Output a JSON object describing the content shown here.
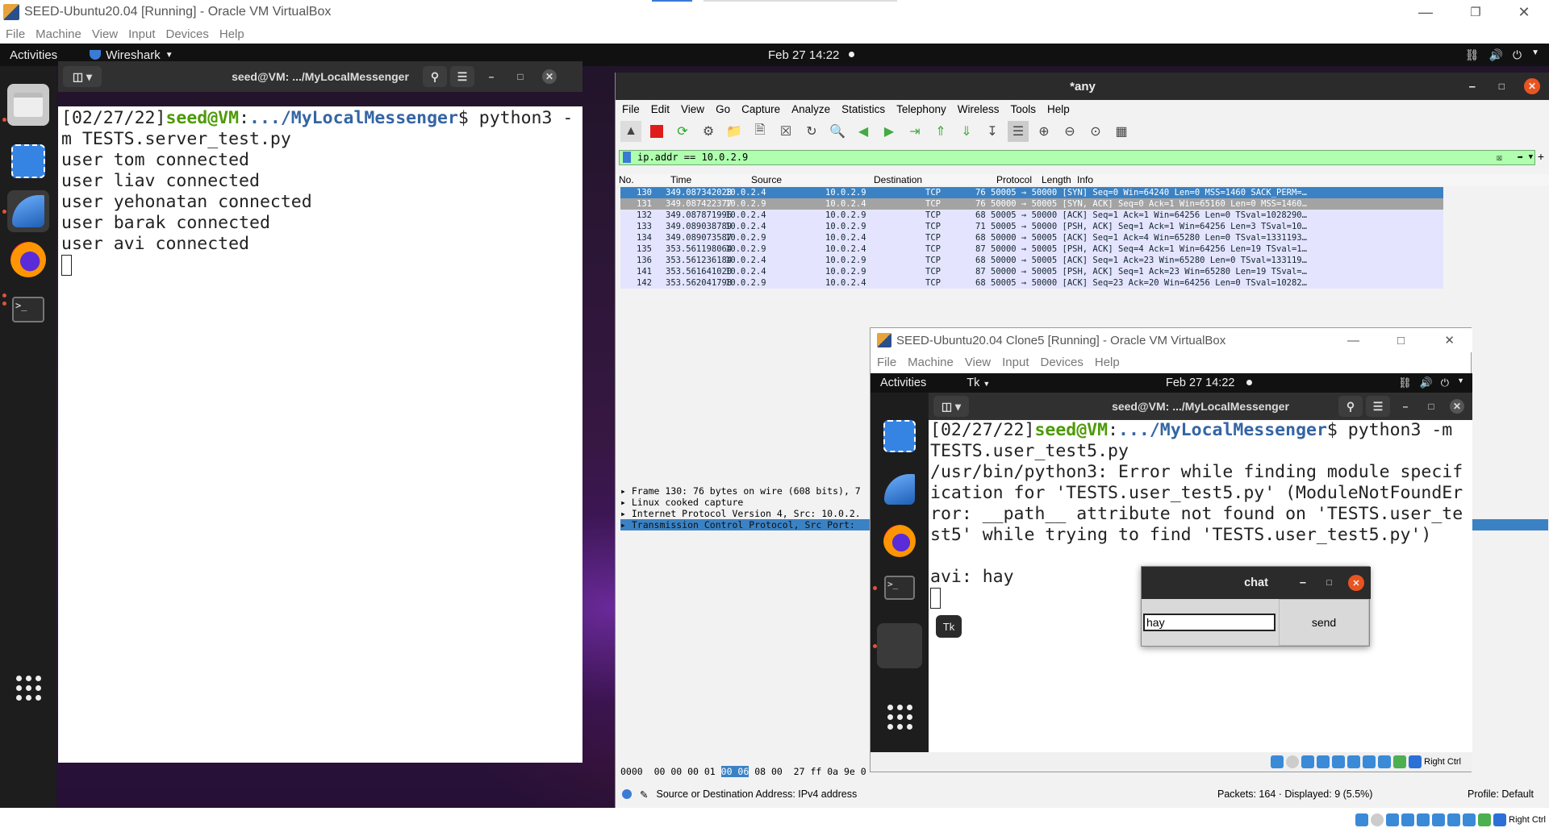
{
  "host": {
    "title": "SEED-Ubuntu20.04 [Running] - Oracle VM VirtualBox",
    "menu": [
      "File",
      "Machine",
      "View",
      "Input",
      "Devices",
      "Help"
    ],
    "status_key": "Right Ctrl"
  },
  "guest": {
    "activities": "Activities",
    "app_menu": "Wireshark",
    "clock": "Feb 27  14:22"
  },
  "terminal": {
    "title": "seed@VM: .../MyLocalMessenger",
    "prompt_date": "[02/27/22]",
    "prompt_user": "seed@VM",
    "prompt_sep": ":",
    "prompt_path": ".../MyLocalMessenger",
    "command": "$ python3 -m TESTS.server_test.py",
    "output": [
      "user tom connected",
      "user liav connected",
      "user yehonatan connected",
      "user barak connected",
      "user avi connected"
    ]
  },
  "wireshark": {
    "title": "*any",
    "menu": [
      "File",
      "Edit",
      "View",
      "Go",
      "Capture",
      "Analyze",
      "Statistics",
      "Telephony",
      "Wireless",
      "Tools",
      "Help"
    ],
    "filter": "ip.addr == 10.0.2.9",
    "columns": [
      "No.",
      "Time",
      "Source",
      "Destination",
      "Protocol",
      "Length",
      "Info"
    ],
    "packets": [
      {
        "no": "130",
        "time": "349.087342028",
        "src": "10.0.2.4",
        "dst": "10.0.2.9",
        "proto": "TCP",
        "len": "76",
        "info": "50005 → 50000 [SYN] Seq=0 Win=64240 Len=0 MSS=1460 SACK_PERM=…"
      },
      {
        "no": "131",
        "time": "349.087422377",
        "src": "10.0.2.9",
        "dst": "10.0.2.4",
        "proto": "TCP",
        "len": "76",
        "info": "50000 → 50005 [SYN, ACK] Seq=0 Ack=1 Win=65160 Len=0 MSS=1460…"
      },
      {
        "no": "132",
        "time": "349.087871996",
        "src": "10.0.2.4",
        "dst": "10.0.2.9",
        "proto": "TCP",
        "len": "68",
        "info": "50005 → 50000 [ACK] Seq=1 Ack=1 Win=64256 Len=0 TSval=1028290…"
      },
      {
        "no": "133",
        "time": "349.089038789",
        "src": "10.0.2.4",
        "dst": "10.0.2.9",
        "proto": "TCP",
        "len": "71",
        "info": "50005 → 50000 [PSH, ACK] Seq=1 Ack=1 Win=64256 Len=3 TSval=10…"
      },
      {
        "no": "134",
        "time": "349.089073587",
        "src": "10.0.2.9",
        "dst": "10.0.2.4",
        "proto": "TCP",
        "len": "68",
        "info": "50000 → 50005 [ACK] Seq=1 Ack=4 Win=65280 Len=0 TSval=1331193…"
      },
      {
        "no": "135",
        "time": "353.561198064",
        "src": "10.0.2.9",
        "dst": "10.0.2.4",
        "proto": "TCP",
        "len": "87",
        "info": "50000 → 50005 [PSH, ACK] Seq=4 Ack=1 Win=64256 Len=19 TSval=1…"
      },
      {
        "no": "136",
        "time": "353.561236184",
        "src": "10.0.2.4",
        "dst": "10.0.2.9",
        "proto": "TCP",
        "len": "68",
        "info": "50000 → 50005 [ACK] Seq=1 Ack=23 Win=65280 Len=0 TSval=133119…"
      },
      {
        "no": "141",
        "time": "353.561641020",
        "src": "10.0.2.4",
        "dst": "10.0.2.9",
        "proto": "TCP",
        "len": "87",
        "info": "50000 → 50005 [PSH, ACK] Seq=1 Ack=23 Win=65280 Len=19 TSval=…"
      },
      {
        "no": "142",
        "time": "353.562041798",
        "src": "10.0.2.9",
        "dst": "10.0.2.4",
        "proto": "TCP",
        "len": "68",
        "info": "50005 → 50000 [ACK] Seq=23 Ack=20 Win=64256 Len=0 TSval=10282…"
      }
    ],
    "details": [
      "Frame 130: 76 bytes on wire (608 bits), 7",
      "Linux cooked capture",
      "Internet Protocol Version 4, Src: 10.0.2.",
      "Transmission Control Protocol, Src Port:"
    ],
    "bytes_offset": "0000",
    "bytes_a": "00 00 00 01 ",
    "bytes_hl": "00 06",
    "bytes_b": " 08 00  27 ff 0a 9e 0",
    "status_text": "Source or Destination Address: IPv4 address",
    "status_packets": "Packets: 164 · Displayed: 9 (5.5%)",
    "status_profile": "Profile: Default"
  },
  "clone": {
    "title": "SEED-Ubuntu20.04 Clone5 [Running] - Oracle VM VirtualBox",
    "menu": [
      "File",
      "Machine",
      "View",
      "Input",
      "Devices",
      "Help"
    ],
    "activities": "Activities",
    "app_menu": "Tk",
    "clock": "Feb 27  14:22",
    "term_title": "seed@VM: .../MyLocalMessenger",
    "prompt_date": "[02/27/22]",
    "prompt_user": "seed@VM",
    "prompt_sep": ":",
    "prompt_path": ".../MyLocalMessenger",
    "command": "$ python3 -m TESTS.user_test5.py",
    "error": "/usr/bin/python3: Error while finding module specification for 'TESTS.user_test5.py' (ModuleNotFoundError: __path__ attribute not found on 'TESTS.user_test5' while trying to find 'TESTS.user_test5.py')",
    "message": "avi: hay",
    "tooltip": "Tk",
    "status_key": "Right Ctrl"
  },
  "chat": {
    "title": "chat",
    "input_value": "hay",
    "send_label": "send"
  }
}
